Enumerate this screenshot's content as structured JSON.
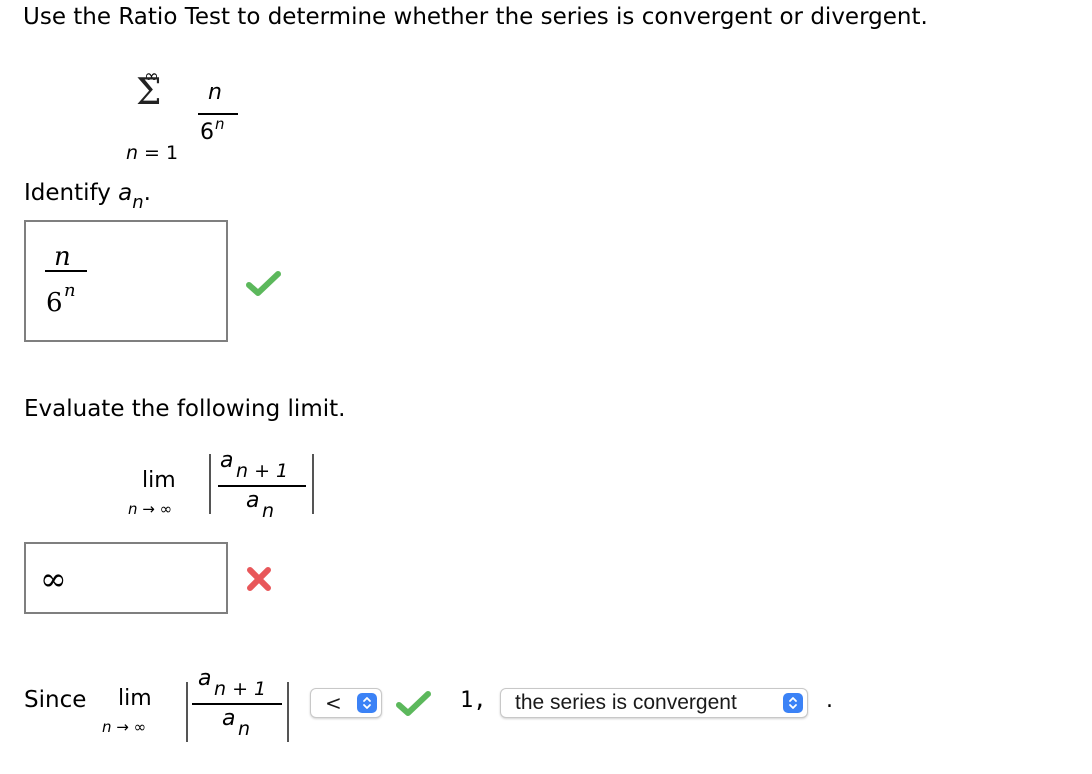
{
  "question": "Use the Ratio Test to determine whether the series is convergent or divergent.",
  "series": {
    "upper": "∞",
    "lower_var": "n",
    "lower_eq": "= 1",
    "numerator": "n",
    "denominator_base": "6",
    "denominator_exp": "n"
  },
  "identify": {
    "label": "Identify",
    "var": "a",
    "sub": "n",
    "period": ".",
    "answer": {
      "numerator": "n",
      "denominator_base": "6",
      "denominator_exp": "n"
    },
    "status": "correct"
  },
  "evaluate": {
    "label": "Evaluate the following limit.",
    "lim": "lim",
    "lim_sub": "n → ∞",
    "num_var": "a",
    "num_sub": "n + 1",
    "den_var": "a",
    "den_sub": "n",
    "answer": "∞",
    "status": "incorrect"
  },
  "conclusion": {
    "since": "Since",
    "lim": "lim",
    "lim_sub": "n → ∞",
    "num_var": "a",
    "num_sub": "n + 1",
    "den_var": "a",
    "den_sub": "n",
    "comparison_selected": "<",
    "comparison_status": "correct",
    "value": "1,",
    "conclusion_selected": "the series is convergent",
    "period": "."
  },
  "colors": {
    "check": "#5cb85c",
    "cross": "#e8575a",
    "select_accent": "#3b82f6"
  }
}
